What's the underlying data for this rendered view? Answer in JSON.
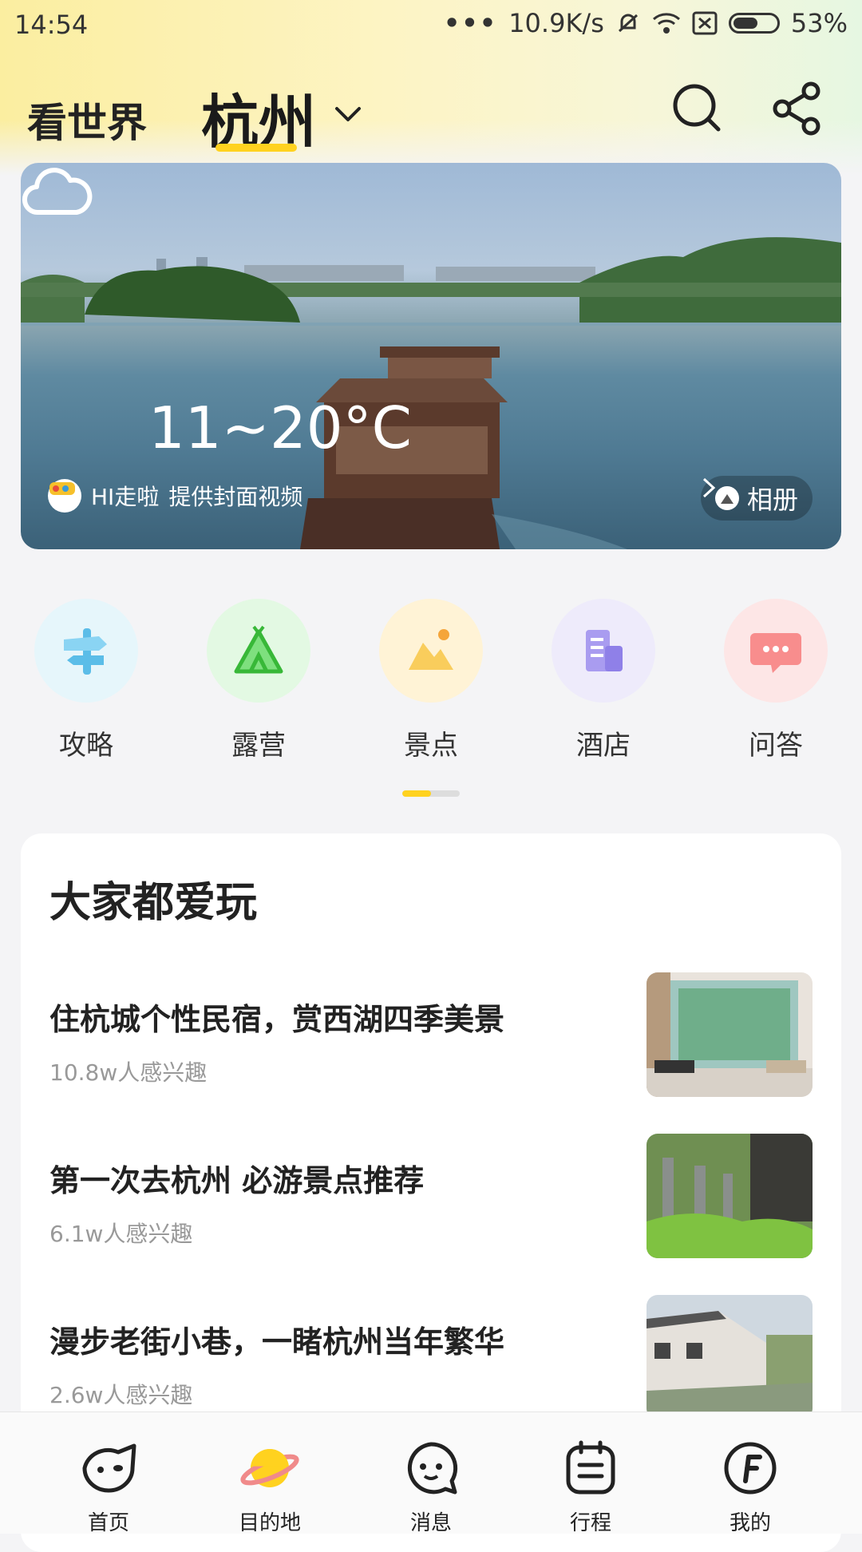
{
  "status_bar": {
    "time": "14:54",
    "speed": "10.9K/s",
    "battery": "53%",
    "battery_level": 0.53
  },
  "header": {
    "tab_world": "看世界",
    "tab_city": "杭州",
    "accent_color": "#ffd21f"
  },
  "hero": {
    "temperature": "11~20°C",
    "credit_name": "HI走啦",
    "credit_text": "提供封面视频",
    "album_label": "相册"
  },
  "categories": [
    {
      "label": "攻略",
      "icon": "signpost-icon"
    },
    {
      "label": "露营",
      "icon": "tent-icon"
    },
    {
      "label": "景点",
      "icon": "mountain-icon"
    },
    {
      "label": "酒店",
      "icon": "hotel-icon"
    },
    {
      "label": "问答",
      "icon": "chat-icon"
    }
  ],
  "popular": {
    "title": "大家都爱玩",
    "items": [
      {
        "title": "住杭城个性民宿，赏西湖四季美景",
        "subtitle": "10.8w人感兴趣"
      },
      {
        "title": "第一次去杭州 必游景点推荐",
        "subtitle": "6.1w人感兴趣"
      },
      {
        "title": "漫步老街小巷，一睹杭州当年繁华",
        "subtitle": "2.6w人感兴趣"
      }
    ]
  },
  "bottom_nav": [
    {
      "label": "首页",
      "icon": "pig-icon"
    },
    {
      "label": "目的地",
      "icon": "planet-icon"
    },
    {
      "label": "消息",
      "icon": "message-icon"
    },
    {
      "label": "行程",
      "icon": "calendar-icon"
    },
    {
      "label": "我的",
      "icon": "profile-f-icon"
    }
  ]
}
